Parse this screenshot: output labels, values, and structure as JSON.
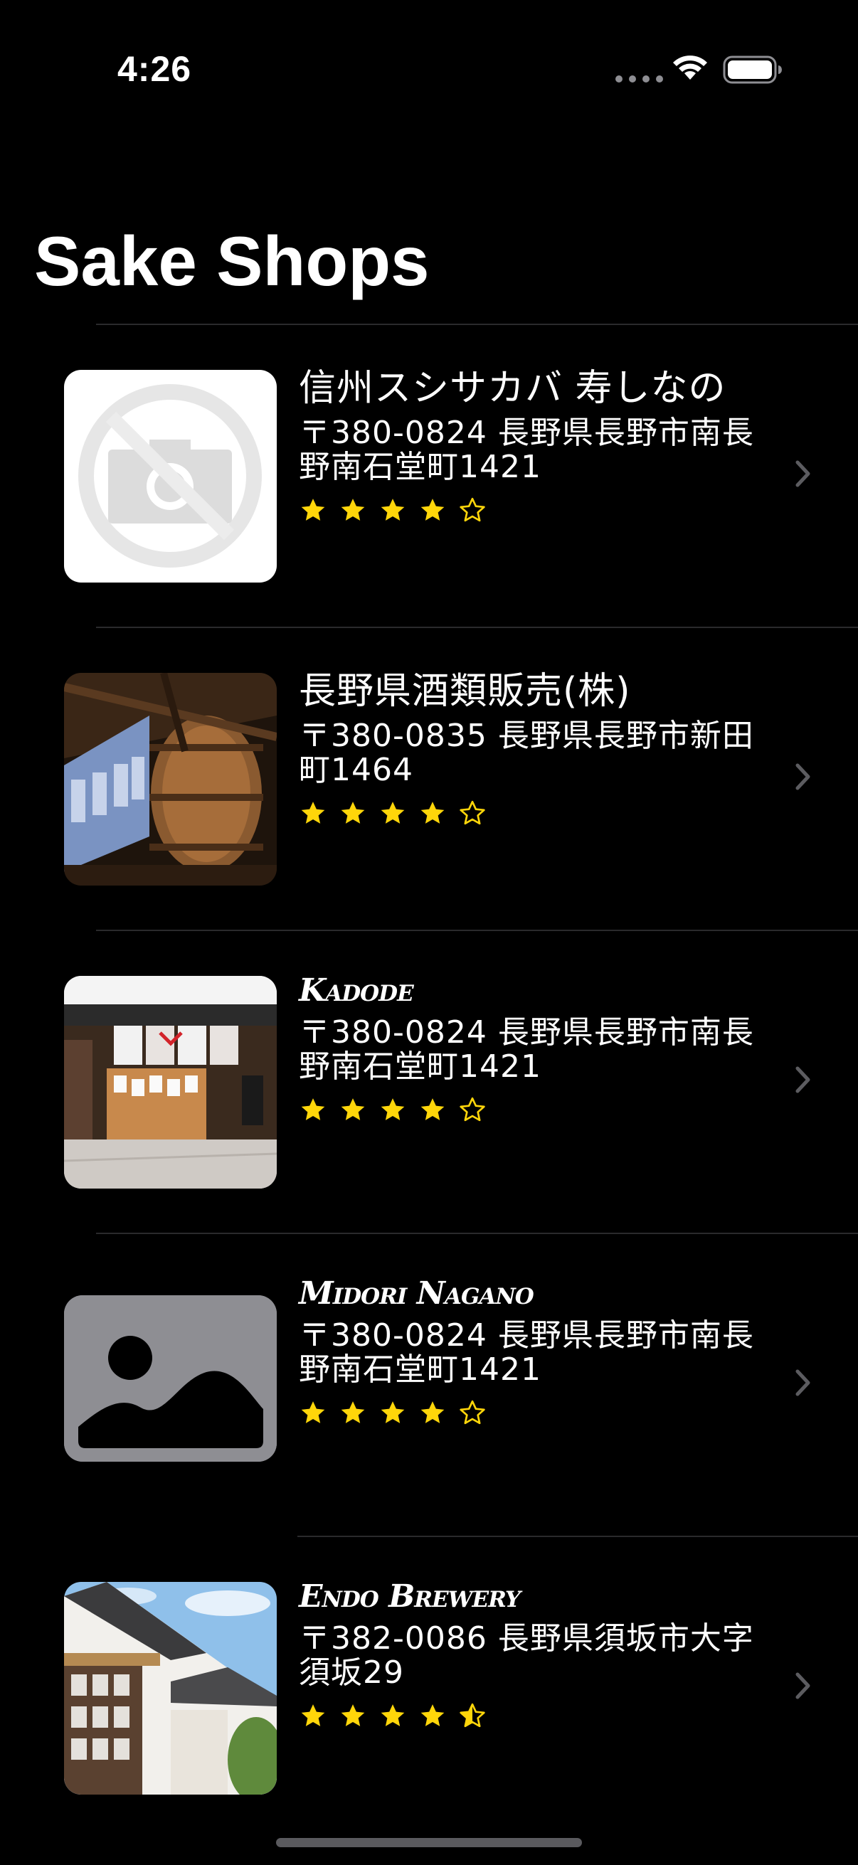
{
  "status_bar": {
    "time": "4:26"
  },
  "nav": {
    "title": "Sake Shops"
  },
  "colors": {
    "background": "#000000",
    "separator": "#2a2a2c",
    "star": "#ffd60a",
    "chevron": "#5c5c60",
    "placeholder": "#8e8e93"
  },
  "shops": [
    {
      "name": "信州スシサカバ 寿しなの",
      "address": "〒380-0824 長野県長野市南長野南石堂町1421",
      "rating": 4,
      "image": "no-photo-icon"
    },
    {
      "name": "長野県酒類販売(株)",
      "address": "〒380-0835 長野県長野市新田町1464",
      "rating": 4,
      "image": "brewery-interior-photo"
    },
    {
      "name": "Kadode",
      "address": "〒380-0824 長野県長野市南長野南石堂町1421",
      "rating": 4,
      "image": "storefront-photo"
    },
    {
      "name": "Midori Nagano",
      "address": "〒380-0824 長野県長野市南長野南石堂町1421",
      "rating": 4,
      "image": "image-placeholder-icon"
    },
    {
      "name": "Endo Brewery",
      "address": "〒382-0086 長野県須坂市大字須坂29",
      "rating": 4.5,
      "image": "brewery-exterior-photo"
    }
  ]
}
